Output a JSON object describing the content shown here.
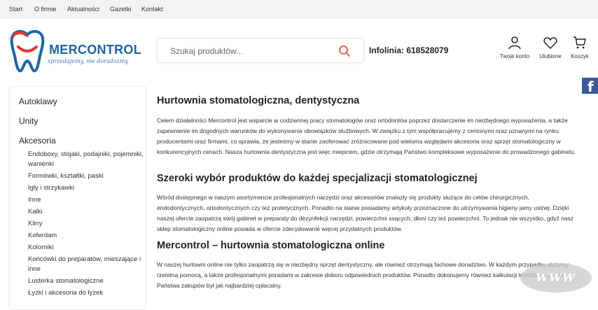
{
  "topnav": {
    "items": [
      "Start",
      "O firmie",
      "Aktualności",
      "Gazetki",
      "Kontakt"
    ]
  },
  "header": {
    "logo_text": "MERCONTROL",
    "logo_tagline": "sprzedajemy, nie doradzamy",
    "search_placeholder": "Szukaj produktów...",
    "infolinia": "Infolinia:  618528079",
    "account_label": "Twoje konto",
    "favorites_label": "Ulubione",
    "cart_label": "Koszyk"
  },
  "social": {
    "facebook_icon": "facebook-icon",
    "facebook_glyph": "f"
  },
  "sidebar": {
    "categories": [
      "Autoklawy",
      "Unity",
      "Akcesoria"
    ],
    "subcategories": [
      "Endoboxy, stojaki, podajniki, pojemniki, wanienki",
      "Formówki, kształtki, paski",
      "Igły i strzykawki",
      "Inne",
      "Kalki",
      "Kliny",
      "Koferdam",
      "Kolorniki",
      "Końcówki do preparatów, mieszające i inne",
      "Lusterka stomatologiczne",
      "Łyżki i akcesoria do łyżek"
    ]
  },
  "content": {
    "h1": "Hurtownia stomatologiczna, dentystyczna",
    "p1": "Celem działalności Mercontrol jest wsparcie w codziennej pracy stomatologów oraz ortodontów poprzez dostarczenie im niezbędnego wyposażenia, a także zapewnienie im dogodnych warunków do wykonywania obowiązków służbowych. W związku z tym współpracujemy z cenionymi oraz uznanymi na rynku producentami oraz firmami, co sprawia, że jesteśmy w stanie zaoferować zróżnicowane pod wieloma względami akcesoria oraz sprzęt stomatologiczny w konkurencyjnych cenach. Nasza hurtownia dentystyczna jest więc miejscem, gdzie otrzymają Państwo kompleksowe wyposażenie do prowadzonego gabinetu.",
    "h2": "Szeroki wybór produktów do każdej specjalizacji stomatologicznej",
    "p2": "Wśród dostępnego w naszym asortymencie profesjonalnych narzędzi oraz akcesoriów znalazły się produkty służące do celów chirurgicznych, endodontycznych, ortodontycznych czy też protetycznych. Ponadto na stanie posiadamy artykuły przeznaczone do utrzymywania higieny jamy ustnej. Dzięki naszej ofercie zaopatrzą swój gabinet w preparaty do dezynfekcji narzędzi, powierzchni ssących, dłoni czy też powierzchni. To jednak nie wszystko, gdyż nasz sklep stomatologiczny online posiada w ofercie zdecydowanie więcej przydatnych produktów.",
    "h3": "Mercontrol – hurtownia stomatologiczna online",
    "p3": "W naszej hurtowni online nie tylko zaopatrzą się w niezbędny sprzęt dentystyczny, ale również otrzymają fachowe doradztwo. W każdym przypadku służymy rzetelną pomocą, a także profesjonalnymi poradami w zakresie doboru odpowiednich produktów. Ponadto dokonujemy również kalkulacji kosztów, by każdy z Państwa zakupów był jak najbardziej opłacalny."
  },
  "watermark": {
    "text": "WWW"
  },
  "colors": {
    "brand_blue": "#1f64a6",
    "brand_red": "#e53935",
    "topnav_bg": "#f2f4f4",
    "search_icon": "#e8542f"
  }
}
